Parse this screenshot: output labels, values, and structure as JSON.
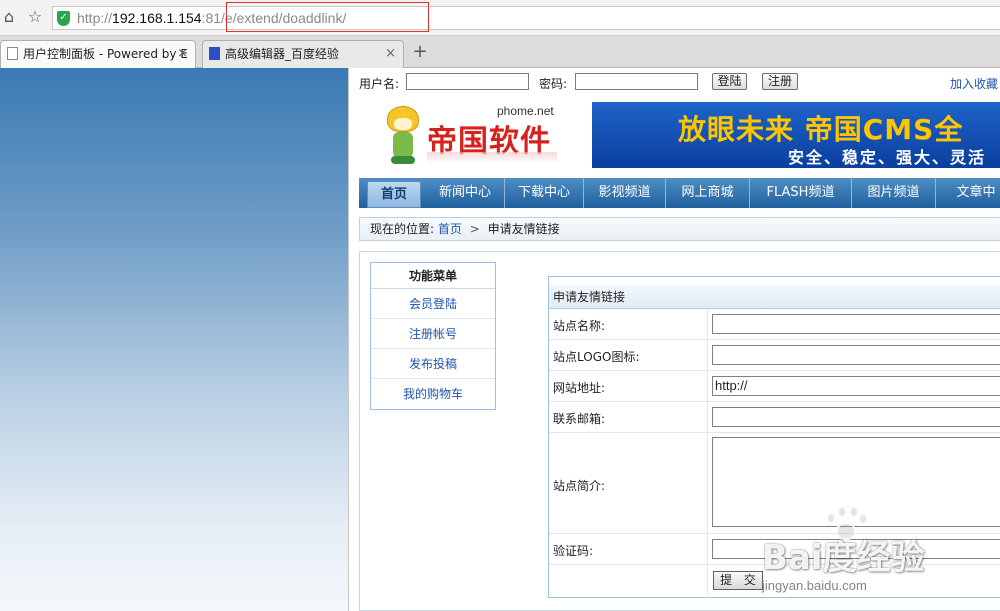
{
  "browser": {
    "url_scheme": "http://",
    "url_host": "192.168.1.154",
    "url_rest": ":81/e/extend/doaddlink/",
    "tabs": [
      {
        "label": "用户控制面板 - Powered by E",
        "close": "×"
      },
      {
        "label": "高级编辑器_百度经验",
        "close": "×"
      }
    ],
    "new_tab": "+",
    "home_glyph": "⌂",
    "star_glyph": "☆",
    "shield_glyph": "✓"
  },
  "login_bar": {
    "username_label": "用户名:",
    "password_label": "密码:",
    "login_button": "登陆",
    "register_button": "注册",
    "favorite_link": "加入收藏"
  },
  "logo": {
    "sub": "phome.net",
    "main": "帝国软件"
  },
  "banner": {
    "line1": "放眼未来 帝国CMS全",
    "line2": "安全、稳定、强大、灵活"
  },
  "nav": {
    "items": [
      "首页",
      "新闻中心",
      "下载中心",
      "影视频道",
      "网上商城",
      "FLASH频道",
      "图片频道",
      "文章中"
    ]
  },
  "breadcrumb": {
    "prefix": "现在的位置:",
    "home": "首页",
    "sep": ">",
    "current": "申请友情链接"
  },
  "func_menu": {
    "title": "功能菜单",
    "items": [
      "会员登陆",
      "注册帐号",
      "发布投稿",
      "我的购物车"
    ]
  },
  "form": {
    "title": "申请友情链接",
    "site_name_label": "站点名称:",
    "logo_label": "站点LOGO图标:",
    "url_label": "网站地址:",
    "url_value": "http://",
    "email_label": "联系邮箱:",
    "intro_label": "站点简介:",
    "captcha_label": "验证码:",
    "submit": "提 交"
  },
  "watermark": {
    "text": "Bai度经验",
    "url": "jingyan.baidu.com"
  },
  "colors": {
    "nav_bar": "#2a6aa8",
    "link": "#1c54b0",
    "logo_red": "#d7211d",
    "banner_yellow": "#ffc600",
    "url_highlight": "#e03030"
  }
}
